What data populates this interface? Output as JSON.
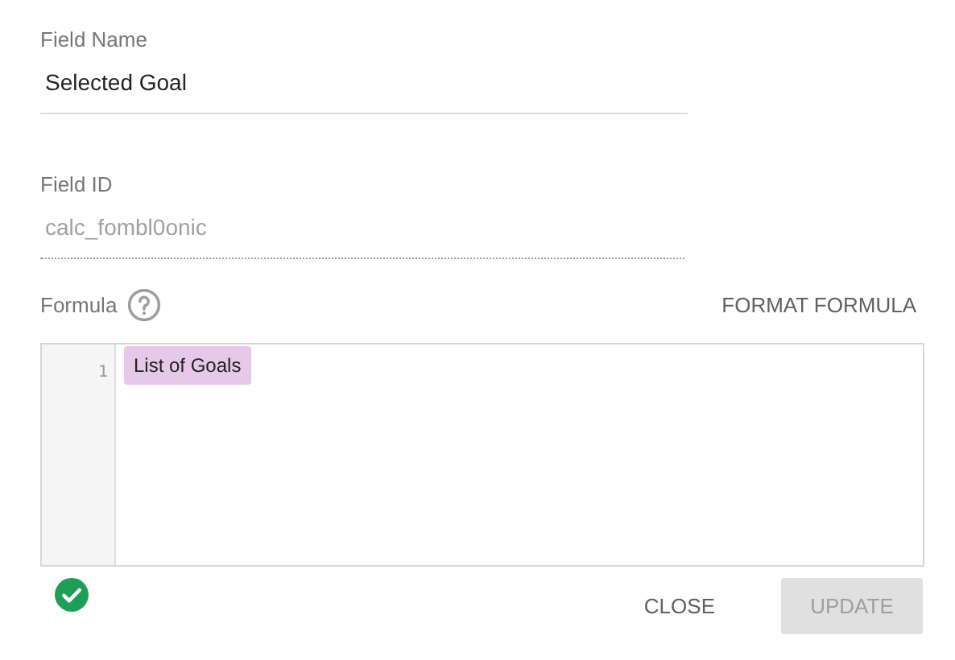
{
  "field_name": {
    "label": "Field Name",
    "value": "Selected Goal"
  },
  "field_id": {
    "label": "Field ID",
    "value": "calc_fombl0onic",
    "disabled": true
  },
  "formula": {
    "label": "Formula",
    "format_button": "FORMAT FORMULA",
    "lines": [
      {
        "number": "1",
        "tokens": [
          {
            "text": "List of Goals",
            "kind": "field"
          }
        ]
      }
    ],
    "valid": true
  },
  "buttons": [
    {
      "label": "CLOSE",
      "disabled": false
    },
    {
      "label": "UPDATE",
      "disabled": true
    }
  ]
}
